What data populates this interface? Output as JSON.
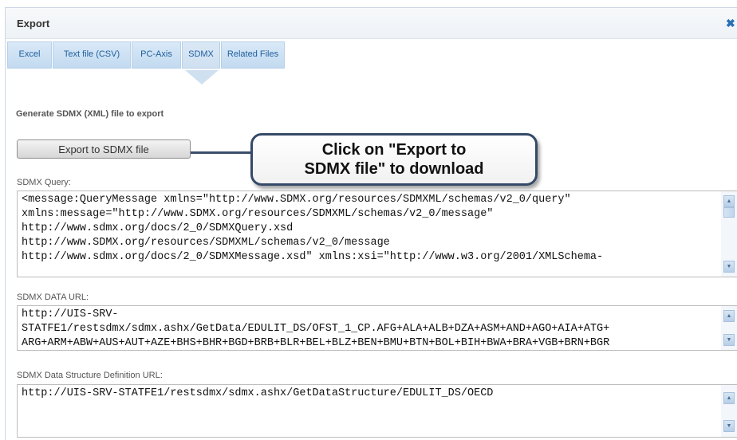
{
  "dialog": {
    "title": "Export",
    "close_icon": "close-icon",
    "close_glyph": "✖"
  },
  "tabs": [
    {
      "label": "Excel"
    },
    {
      "label": "Text file (CSV)"
    },
    {
      "label": "PC-Axis"
    },
    {
      "label": "SDMX",
      "active": true
    },
    {
      "label": "Related Files"
    }
  ],
  "sdmx": {
    "heading": "Generate SDMX (XML) file to export",
    "export_button_label": "Export to SDMX file",
    "callout_line1": "Click on \"Export to",
    "callout_line2": "SDMX file\" to download",
    "query_label": "SDMX Query:",
    "query_text": "<message:QueryMessage xmlns=\"http://www.SDMX.org/resources/SDMXML/schemas/v2_0/query\"\nxmlns:message=\"http://www.SDMX.org/resources/SDMXML/schemas/v2_0/message\"\nhttp://www.sdmx.org/docs/2_0/SDMXQuery.xsd\nhttp://www.SDMX.org/resources/SDMXML/schemas/v2_0/message\nhttp://www.sdmx.org/docs/2_0/SDMXMessage.xsd\" xmlns:xsi=\"http://www.w3.org/2001/XMLSchema-",
    "data_url_label": "SDMX DATA URL:",
    "data_url_text": "http://UIS-SRV-\nSTATFE1/restsdmx/sdmx.ashx/GetData/EDULIT_DS/OFST_1_CP.AFG+ALA+ALB+DZA+ASM+AND+AGO+AIA+ATG+\nARG+ARM+ABW+AUS+AUT+AZE+BHS+BHR+BGD+BRB+BLR+BEL+BLZ+BEN+BMU+BTN+BOL+BIH+BWA+BRA+VGB+BRN+BGR",
    "dsd_url_label": "SDMX Data Structure Definition URL:",
    "dsd_url_text": "http://UIS-SRV-STATFE1/restsdmx/sdmx.ashx/GetDataStructure/EDULIT_DS/OECD"
  },
  "scrollbar": {
    "up_glyph": "▲",
    "down_glyph": "▼"
  },
  "colors": {
    "tab_text": "#1f5f9e",
    "callout_border": "#354a68",
    "close_icon": "#2a6fb5"
  }
}
